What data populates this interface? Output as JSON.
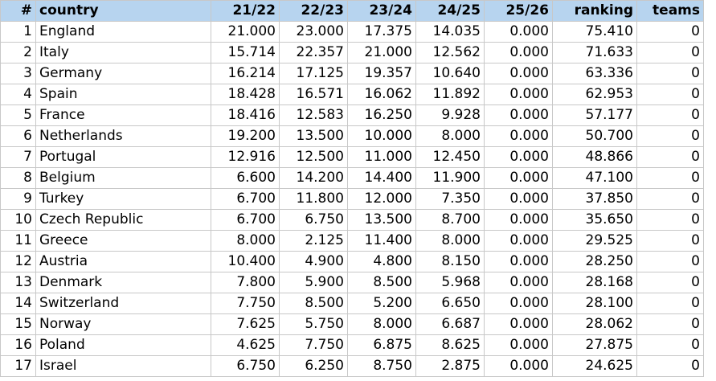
{
  "table": {
    "headers": {
      "index": "#",
      "country": "country",
      "y2122": "21/22",
      "y2223": "22/23",
      "y2324": "23/24",
      "y2425": "24/25",
      "y2526": "25/26",
      "ranking": "ranking",
      "teams": "teams"
    },
    "rows": [
      {
        "index": "1",
        "country": "England",
        "y2122": "21.000",
        "y2223": "23.000",
        "y2324": "17.375",
        "y2425": "14.035",
        "y2526": "0.000",
        "ranking": "75.410",
        "teams": "0"
      },
      {
        "index": "2",
        "country": "Italy",
        "y2122": "15.714",
        "y2223": "22.357",
        "y2324": "21.000",
        "y2425": "12.562",
        "y2526": "0.000",
        "ranking": "71.633",
        "teams": "0"
      },
      {
        "index": "3",
        "country": "Germany",
        "y2122": "16.214",
        "y2223": "17.125",
        "y2324": "19.357",
        "y2425": "10.640",
        "y2526": "0.000",
        "ranking": "63.336",
        "teams": "0"
      },
      {
        "index": "4",
        "country": "Spain",
        "y2122": "18.428",
        "y2223": "16.571",
        "y2324": "16.062",
        "y2425": "11.892",
        "y2526": "0.000",
        "ranking": "62.953",
        "teams": "0"
      },
      {
        "index": "5",
        "country": "France",
        "y2122": "18.416",
        "y2223": "12.583",
        "y2324": "16.250",
        "y2425": "9.928",
        "y2526": "0.000",
        "ranking": "57.177",
        "teams": "0"
      },
      {
        "index": "6",
        "country": "Netherlands",
        "y2122": "19.200",
        "y2223": "13.500",
        "y2324": "10.000",
        "y2425": "8.000",
        "y2526": "0.000",
        "ranking": "50.700",
        "teams": "0"
      },
      {
        "index": "7",
        "country": "Portugal",
        "y2122": "12.916",
        "y2223": "12.500",
        "y2324": "11.000",
        "y2425": "12.450",
        "y2526": "0.000",
        "ranking": "48.866",
        "teams": "0"
      },
      {
        "index": "8",
        "country": "Belgium",
        "y2122": "6.600",
        "y2223": "14.200",
        "y2324": "14.400",
        "y2425": "11.900",
        "y2526": "0.000",
        "ranking": "47.100",
        "teams": "0"
      },
      {
        "index": "9",
        "country": "Turkey",
        "y2122": "6.700",
        "y2223": "11.800",
        "y2324": "12.000",
        "y2425": "7.350",
        "y2526": "0.000",
        "ranking": "37.850",
        "teams": "0"
      },
      {
        "index": "10",
        "country": "Czech Republic",
        "y2122": "6.700",
        "y2223": "6.750",
        "y2324": "13.500",
        "y2425": "8.700",
        "y2526": "0.000",
        "ranking": "35.650",
        "teams": "0"
      },
      {
        "index": "11",
        "country": "Greece",
        "y2122": "8.000",
        "y2223": "2.125",
        "y2324": "11.400",
        "y2425": "8.000",
        "y2526": "0.000",
        "ranking": "29.525",
        "teams": "0"
      },
      {
        "index": "12",
        "country": "Austria",
        "y2122": "10.400",
        "y2223": "4.900",
        "y2324": "4.800",
        "y2425": "8.150",
        "y2526": "0.000",
        "ranking": "28.250",
        "teams": "0"
      },
      {
        "index": "13",
        "country": "Denmark",
        "y2122": "7.800",
        "y2223": "5.900",
        "y2324": "8.500",
        "y2425": "5.968",
        "y2526": "0.000",
        "ranking": "28.168",
        "teams": "0"
      },
      {
        "index": "14",
        "country": "Switzerland",
        "y2122": "7.750",
        "y2223": "8.500",
        "y2324": "5.200",
        "y2425": "6.650",
        "y2526": "0.000",
        "ranking": "28.100",
        "teams": "0"
      },
      {
        "index": "15",
        "country": "Norway",
        "y2122": "7.625",
        "y2223": "5.750",
        "y2324": "8.000",
        "y2425": "6.687",
        "y2526": "0.000",
        "ranking": "28.062",
        "teams": "0"
      },
      {
        "index": "16",
        "country": "Poland",
        "y2122": "4.625",
        "y2223": "7.750",
        "y2324": "6.875",
        "y2425": "8.625",
        "y2526": "0.000",
        "ranking": "27.875",
        "teams": "0"
      },
      {
        "index": "17",
        "country": "Israel",
        "y2122": "6.750",
        "y2223": "6.250",
        "y2324": "8.750",
        "y2425": "2.875",
        "y2526": "0.000",
        "ranking": "24.625",
        "teams": "0"
      }
    ]
  },
  "colors": {
    "header_background": "#b7d4ef",
    "grid_border": "#c8c8c8"
  }
}
